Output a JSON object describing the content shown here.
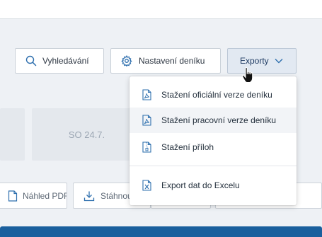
{
  "toolbar": {
    "search_label": "Vyhledávání",
    "settings_label": "Nastavení deníku",
    "export_label": "Exporty"
  },
  "day_cards": {
    "mid_label": "SO 24.7."
  },
  "actions": {
    "pdf_preview_label": "Náhled PDF",
    "download_label": "Stáhnou"
  },
  "export_menu": {
    "items": [
      {
        "label": "Stažení oficiální verze deníku",
        "icon": "pdf-file-icon"
      },
      {
        "label": "Stažení pracovní verze deníku",
        "icon": "pdf-file-icon"
      },
      {
        "label": "Stažení příloh",
        "icon": "zip-file-icon"
      },
      {
        "label": "Export dat do Excelu",
        "icon": "excel-file-icon"
      }
    ]
  },
  "colors": {
    "accent": "#1a5f9d",
    "icon_blue": "#2e6fae",
    "export_button_bg": "#e2e9f2"
  }
}
